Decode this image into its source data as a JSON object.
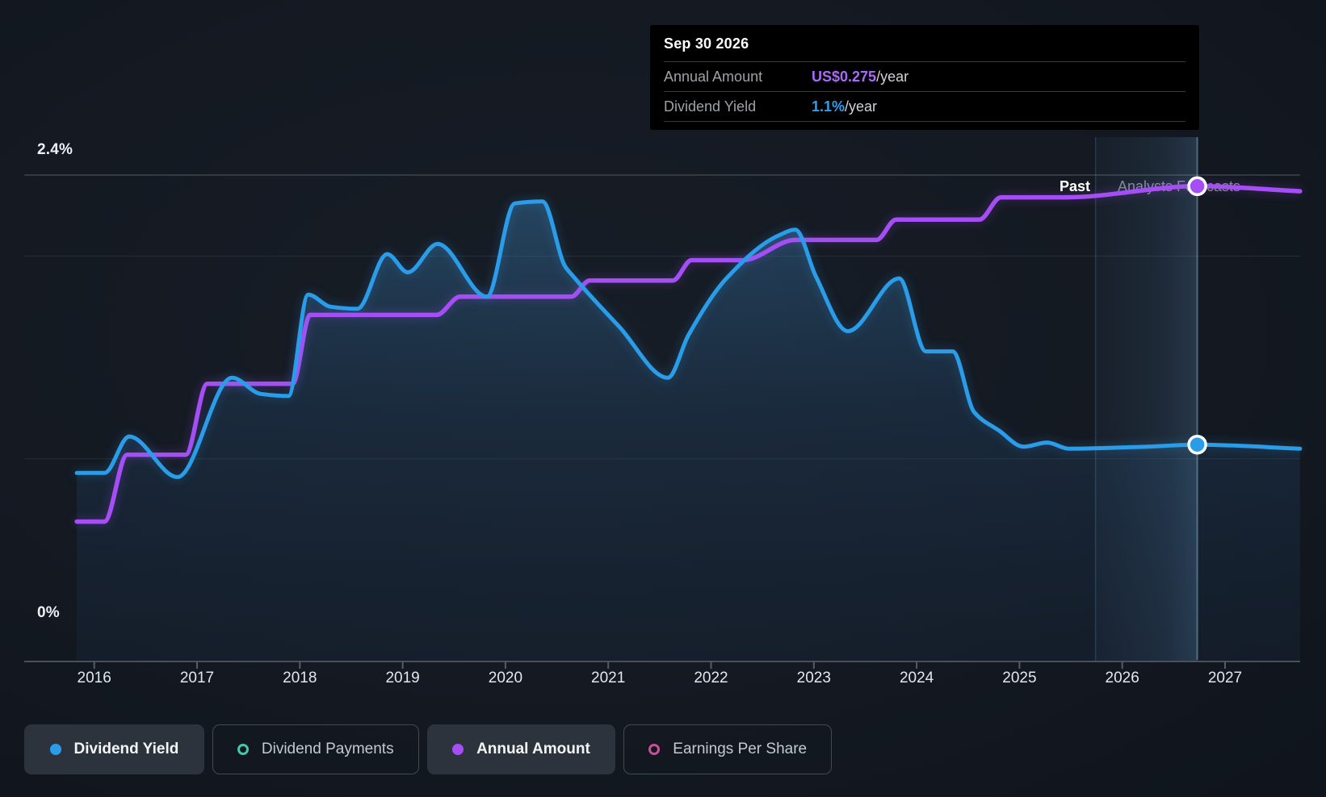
{
  "colors": {
    "background": "#141922",
    "dividend_yield_blue": "#2b9ce8",
    "annual_amount_purple": "#a64ef5",
    "dividend_payments_teal": "#41c9ae",
    "earnings_per_share_pink": "#c94f9b",
    "tooltip_value_purple": "#a96bf7",
    "tooltip_value_blue": "#2da0f0",
    "grid_major": "#3e444d",
    "grid_minor": "#272d35",
    "axis_line": "#49505a",
    "cursor_line": "rgba(160,200,230,0.40)"
  },
  "tooltip": {
    "date": "Sep 30 2026",
    "rows": [
      {
        "label": "Annual Amount",
        "value": "US$0.275",
        "suffix": "/year",
        "value_color": "#a96bf7"
      },
      {
        "label": "Dividend Yield",
        "value": "1.1%",
        "suffix": "/year",
        "value_color": "#2da0f0"
      }
    ]
  },
  "y_axis": {
    "top_label": "2.4%",
    "bottom_label": "0%"
  },
  "period_labels": {
    "past": "Past",
    "forecast": "Analysts Forecasts"
  },
  "legend": [
    {
      "label": "Dividend Yield",
      "marker": "filled",
      "color": "#2b9ce8",
      "active": true
    },
    {
      "label": "Dividend Payments",
      "marker": "ring",
      "color": "#41c9ae",
      "active": false
    },
    {
      "label": "Annual Amount",
      "marker": "filled",
      "color": "#a64ef5",
      "active": true
    },
    {
      "label": "Earnings Per Share",
      "marker": "ring",
      "color": "#c94f9b",
      "active": false
    }
  ],
  "chart_data": {
    "type": "line",
    "x_range_years": [
      2015.83,
      2027.75
    ],
    "y_range_pct": [
      0,
      2.4
    ],
    "y_gridlines_pct": [
      2.4,
      2.0,
      1.0,
      0
    ],
    "x_ticks_years": [
      2016,
      2017,
      2018,
      2019,
      2020,
      2021,
      2022,
      2023,
      2024,
      2025,
      2026,
      2027
    ],
    "forecast_start_year": 2025.74,
    "grid": true,
    "legend_position": "bottom",
    "cursor": {
      "date": "Sep 30 2026",
      "year": 2026.73,
      "dividend_yield_pct": 1.07,
      "annual_amount_usd_per_year": 0.275,
      "annual_amount_plot_pct": 2.345
    },
    "series": [
      {
        "name": "Dividend Yield",
        "color": "#2b9ce8",
        "unit": "%",
        "area_fill": true,
        "points": [
          [
            2015.83,
            0.93
          ],
          [
            2016.1,
            0.93
          ],
          [
            2016.34,
            1.11
          ],
          [
            2016.81,
            0.91
          ],
          [
            2017.34,
            1.4
          ],
          [
            2017.62,
            1.32
          ],
          [
            2017.89,
            1.31
          ],
          [
            2018.08,
            1.81
          ],
          [
            2018.3,
            1.75
          ],
          [
            2018.56,
            1.74
          ],
          [
            2018.85,
            2.01
          ],
          [
            2019.05,
            1.92
          ],
          [
            2019.34,
            2.06
          ],
          [
            2019.82,
            1.8
          ],
          [
            2020.09,
            2.26
          ],
          [
            2020.36,
            2.27
          ],
          [
            2020.58,
            1.95
          ],
          [
            2020.66,
            1.9
          ],
          [
            2021.11,
            1.65
          ],
          [
            2021.58,
            1.4
          ],
          [
            2021.78,
            1.61
          ],
          [
            2022.15,
            1.89
          ],
          [
            2022.65,
            2.1
          ],
          [
            2022.82,
            2.13
          ],
          [
            2023.02,
            1.9
          ],
          [
            2023.33,
            1.63
          ],
          [
            2023.83,
            1.89
          ],
          [
            2024.09,
            1.53
          ],
          [
            2024.35,
            1.53
          ],
          [
            2024.56,
            1.23
          ],
          [
            2024.8,
            1.14
          ],
          [
            2025.04,
            1.06
          ],
          [
            2025.27,
            1.08
          ],
          [
            2025.48,
            1.05
          ],
          [
            2026.24,
            1.06
          ],
          [
            2026.73,
            1.07
          ],
          [
            2027.73,
            1.05
          ]
        ]
      },
      {
        "name": "Annual Amount",
        "color": "#a64ef5",
        "unit": "plotted on hidden US$ axis; values below are left-axis % equivalents",
        "area_fill": false,
        "points": [
          [
            2015.83,
            0.69
          ],
          [
            2016.1,
            0.69
          ],
          [
            2016.32,
            1.02
          ],
          [
            2016.89,
            1.02
          ],
          [
            2017.1,
            1.37
          ],
          [
            2017.93,
            1.37
          ],
          [
            2018.1,
            1.71
          ],
          [
            2019.33,
            1.71
          ],
          [
            2019.56,
            1.8
          ],
          [
            2020.64,
            1.8
          ],
          [
            2020.82,
            1.88
          ],
          [
            2021.63,
            1.88
          ],
          [
            2021.81,
            1.98
          ],
          [
            2022.31,
            1.98
          ],
          [
            2022.82,
            2.08
          ],
          [
            2023.61,
            2.08
          ],
          [
            2023.8,
            2.18
          ],
          [
            2024.61,
            2.18
          ],
          [
            2024.82,
            2.29
          ],
          [
            2025.45,
            2.29
          ],
          [
            2026.73,
            2.345
          ],
          [
            2027.73,
            2.32
          ]
        ]
      }
    ]
  }
}
